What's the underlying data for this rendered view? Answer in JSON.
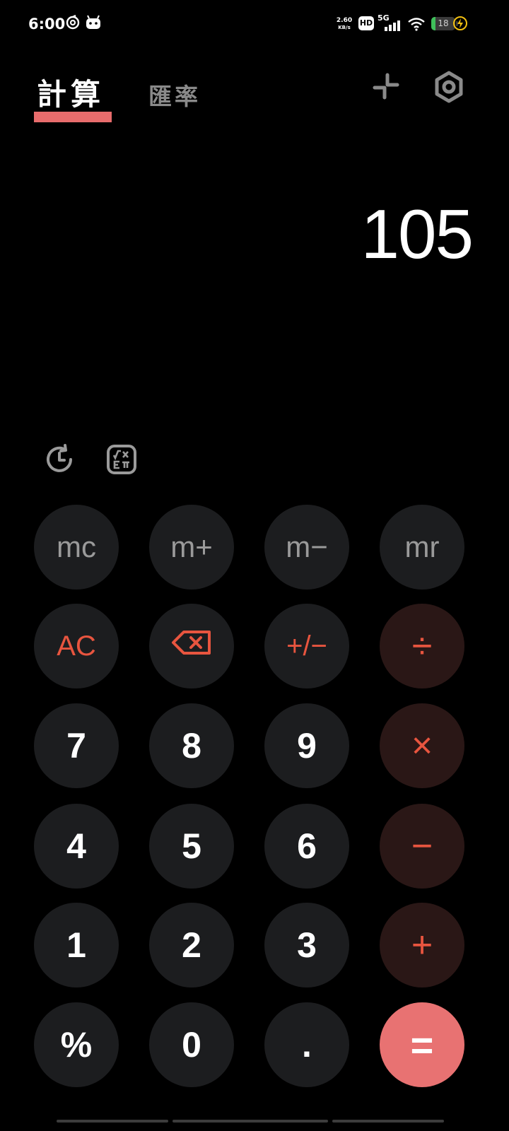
{
  "status_bar": {
    "time": "6:00",
    "net_speed_value": "2.60",
    "net_speed_unit": "KB/s",
    "hd_label": "HD",
    "network_label": "5G",
    "battery_level": "18",
    "battery_fraction": 0.18,
    "icons": [
      "notification-swirl-icon",
      "android-bot-icon",
      "signal-icon",
      "wifi-icon",
      "battery-icon",
      "charging-icon"
    ]
  },
  "header": {
    "tabs": [
      {
        "label": "計算",
        "active": true
      },
      {
        "label": "匯率",
        "active": false
      }
    ],
    "icons": [
      "collapse-icon",
      "settings-icon"
    ],
    "accent_color": "#e86c6c"
  },
  "display": {
    "value": "105"
  },
  "tools": {
    "icons": [
      "history-icon",
      "scientific-mode-icon"
    ]
  },
  "keypad": {
    "rows": [
      [
        "mc",
        "m+",
        "m−",
        "mr"
      ],
      [
        "AC",
        "backspace",
        "+/−",
        "÷"
      ],
      [
        "7",
        "8",
        "9",
        "×"
      ],
      [
        "4",
        "5",
        "6",
        "−"
      ],
      [
        "1",
        "2",
        "3",
        "+"
      ],
      [
        "%",
        "0",
        ".",
        "="
      ]
    ],
    "colors": {
      "key_background": "#1c1d1f",
      "operator_background": "#2a1716",
      "operator_text": "#e8553f",
      "equals_background": "#e87272"
    }
  }
}
